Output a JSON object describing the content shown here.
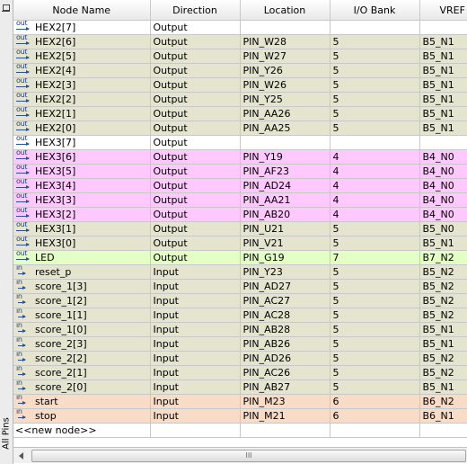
{
  "side_panel": {
    "label": "All Pins",
    "pin_icon": "pin-icon"
  },
  "columns": [
    "Node Name",
    "Direction",
    "Location",
    "I/O Bank",
    "VREF G"
  ],
  "rows": [
    {
      "type": "out",
      "name": "HEX2[7]",
      "direction": "Output",
      "location": "",
      "bank": "",
      "vref": "",
      "color": "plain"
    },
    {
      "type": "out",
      "name": "HEX2[6]",
      "direction": "Output",
      "location": "PIN_W28",
      "bank": "5",
      "vref": "B5_N1",
      "color": "olive"
    },
    {
      "type": "out",
      "name": "HEX2[5]",
      "direction": "Output",
      "location": "PIN_W27",
      "bank": "5",
      "vref": "B5_N1",
      "color": "olive"
    },
    {
      "type": "out",
      "name": "HEX2[4]",
      "direction": "Output",
      "location": "PIN_Y26",
      "bank": "5",
      "vref": "B5_N1",
      "color": "olive"
    },
    {
      "type": "out",
      "name": "HEX2[3]",
      "direction": "Output",
      "location": "PIN_W26",
      "bank": "5",
      "vref": "B5_N1",
      "color": "olive"
    },
    {
      "type": "out",
      "name": "HEX2[2]",
      "direction": "Output",
      "location": "PIN_Y25",
      "bank": "5",
      "vref": "B5_N1",
      "color": "olive"
    },
    {
      "type": "out",
      "name": "HEX2[1]",
      "direction": "Output",
      "location": "PIN_AA26",
      "bank": "5",
      "vref": "B5_N1",
      "color": "olive"
    },
    {
      "type": "out",
      "name": "HEX2[0]",
      "direction": "Output",
      "location": "PIN_AA25",
      "bank": "5",
      "vref": "B5_N1",
      "color": "olive"
    },
    {
      "type": "out",
      "name": "HEX3[7]",
      "direction": "Output",
      "location": "",
      "bank": "",
      "vref": "",
      "color": "plain"
    },
    {
      "type": "out",
      "name": "HEX3[6]",
      "direction": "Output",
      "location": "PIN_Y19",
      "bank": "4",
      "vref": "B4_N0",
      "color": "pink"
    },
    {
      "type": "out",
      "name": "HEX3[5]",
      "direction": "Output",
      "location": "PIN_AF23",
      "bank": "4",
      "vref": "B4_N0",
      "color": "pink"
    },
    {
      "type": "out",
      "name": "HEX3[4]",
      "direction": "Output",
      "location": "PIN_AD24",
      "bank": "4",
      "vref": "B4_N0",
      "color": "pink"
    },
    {
      "type": "out",
      "name": "HEX3[3]",
      "direction": "Output",
      "location": "PIN_AA21",
      "bank": "4",
      "vref": "B4_N0",
      "color": "pink"
    },
    {
      "type": "out",
      "name": "HEX3[2]",
      "direction": "Output",
      "location": "PIN_AB20",
      "bank": "4",
      "vref": "B4_N0",
      "color": "pink"
    },
    {
      "type": "out",
      "name": "HEX3[1]",
      "direction": "Output",
      "location": "PIN_U21",
      "bank": "5",
      "vref": "B5_N0",
      "color": "olive"
    },
    {
      "type": "out",
      "name": "HEX3[0]",
      "direction": "Output",
      "location": "PIN_V21",
      "bank": "5",
      "vref": "B5_N1",
      "color": "olive"
    },
    {
      "type": "out",
      "name": "LED",
      "direction": "Output",
      "location": "PIN_G19",
      "bank": "7",
      "vref": "B7_N2",
      "color": "green"
    },
    {
      "type": "in",
      "name": "reset_p",
      "direction": "Input",
      "location": "PIN_Y23",
      "bank": "5",
      "vref": "B5_N2",
      "color": "olive"
    },
    {
      "type": "in",
      "name": "score_1[3]",
      "direction": "Input",
      "location": "PIN_AD27",
      "bank": "5",
      "vref": "B5_N2",
      "color": "olive"
    },
    {
      "type": "in",
      "name": "score_1[2]",
      "direction": "Input",
      "location": "PIN_AC27",
      "bank": "5",
      "vref": "B5_N2",
      "color": "olive"
    },
    {
      "type": "in",
      "name": "score_1[1]",
      "direction": "Input",
      "location": "PIN_AC28",
      "bank": "5",
      "vref": "B5_N2",
      "color": "olive"
    },
    {
      "type": "in",
      "name": "score_1[0]",
      "direction": "Input",
      "location": "PIN_AB28",
      "bank": "5",
      "vref": "B5_N1",
      "color": "olive"
    },
    {
      "type": "in",
      "name": "score_2[3]",
      "direction": "Input",
      "location": "PIN_AB26",
      "bank": "5",
      "vref": "B5_N1",
      "color": "olive"
    },
    {
      "type": "in",
      "name": "score_2[2]",
      "direction": "Input",
      "location": "PIN_AD26",
      "bank": "5",
      "vref": "B5_N2",
      "color": "olive"
    },
    {
      "type": "in",
      "name": "score_2[1]",
      "direction": "Input",
      "location": "PIN_AC26",
      "bank": "5",
      "vref": "B5_N2",
      "color": "olive"
    },
    {
      "type": "in",
      "name": "score_2[0]",
      "direction": "Input",
      "location": "PIN_AB27",
      "bank": "5",
      "vref": "B5_N1",
      "color": "olive"
    },
    {
      "type": "in",
      "name": "start",
      "direction": "Input",
      "location": "PIN_M23",
      "bank": "6",
      "vref": "B6_N2",
      "color": "peach"
    },
    {
      "type": "in",
      "name": "stop",
      "direction": "Input",
      "location": "PIN_M21",
      "bank": "6",
      "vref": "B6_N1",
      "color": "peach"
    }
  ],
  "new_node_label": "<<new node>>",
  "colors": {
    "plain": "#ffffff",
    "olive": "#e4e4cf",
    "pink": "#ffc8ff",
    "green": "#e4ffc6",
    "peach": "#f9dcc8"
  },
  "icon_labels": {
    "out": "out",
    "in": "in"
  },
  "scrollbar": {
    "grip": "III"
  }
}
